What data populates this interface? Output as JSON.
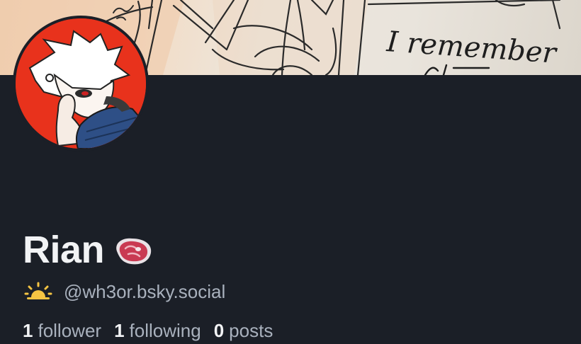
{
  "banner": {
    "handwritten_text": "I remember"
  },
  "profile": {
    "display_name": "Rian",
    "name_emoji": "steak-emoji",
    "handle_prefix_icon": "sun-emoji",
    "handle": "@wh3or.bsky.social"
  },
  "stats": {
    "followers_count": "1",
    "followers_label": "follower",
    "following_count": "1",
    "following_label": "following",
    "posts_count": "0",
    "posts_label": "posts"
  },
  "colors": {
    "background": "#1b1f27",
    "text_primary": "#f2f3f5",
    "text_secondary": "#a9b1bd",
    "avatar_bg": "#e8321c"
  }
}
